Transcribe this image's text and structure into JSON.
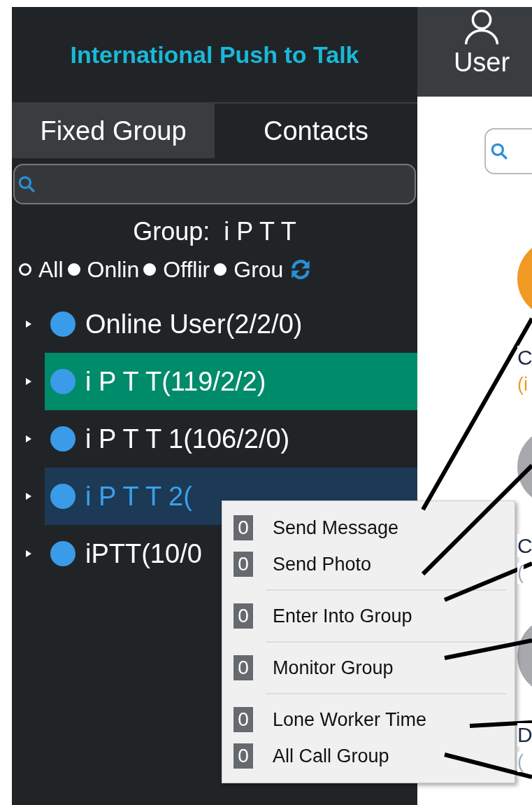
{
  "header": {
    "title": "International Push to Talk"
  },
  "topbar": {
    "user_label": "User"
  },
  "tabs": [
    {
      "label": "Fixed Group",
      "selected": true
    },
    {
      "label": "Contacts",
      "selected": false
    }
  ],
  "group_label": "Group:  i P T T",
  "filters": [
    {
      "label": "All",
      "selected": true
    },
    {
      "label": "Onlin",
      "selected": false
    },
    {
      "label": "Offlir",
      "selected": false
    },
    {
      "label": "Grou",
      "selected": false
    }
  ],
  "groups": [
    {
      "label": "Online User(2/2/0)",
      "current": false,
      "selected": false
    },
    {
      "label": "i P T T(119/2/2)",
      "current": true,
      "selected": false
    },
    {
      "label": "i P T T 1(106/2/0)",
      "current": false,
      "selected": false
    },
    {
      "label": "i P T T 2(",
      "current": false,
      "selected": true
    },
    {
      "label": "iPTT(10/0",
      "current": false,
      "selected": false
    }
  ],
  "context_menu": {
    "items": [
      {
        "badge": "0",
        "label": "Send Message",
        "separator_after": false
      },
      {
        "badge": "0",
        "label": "Send Photo",
        "separator_after": true
      },
      {
        "badge": "0",
        "label": "Enter Into Group",
        "separator_after": true
      },
      {
        "badge": "0",
        "label": "Monitor Group",
        "separator_after": true
      },
      {
        "badge": "0",
        "label": "Lone Worker Time",
        "separator_after": false
      },
      {
        "badge": "0",
        "label": "All Call Group",
        "separator_after": false
      }
    ]
  },
  "contacts": [
    {
      "name": "C",
      "detail": "(i",
      "kind": "online"
    },
    {
      "name": "C",
      "detail": "(",
      "kind": "offline"
    },
    {
      "name": "D",
      "detail": "(",
      "kind": "offline"
    }
  ]
}
